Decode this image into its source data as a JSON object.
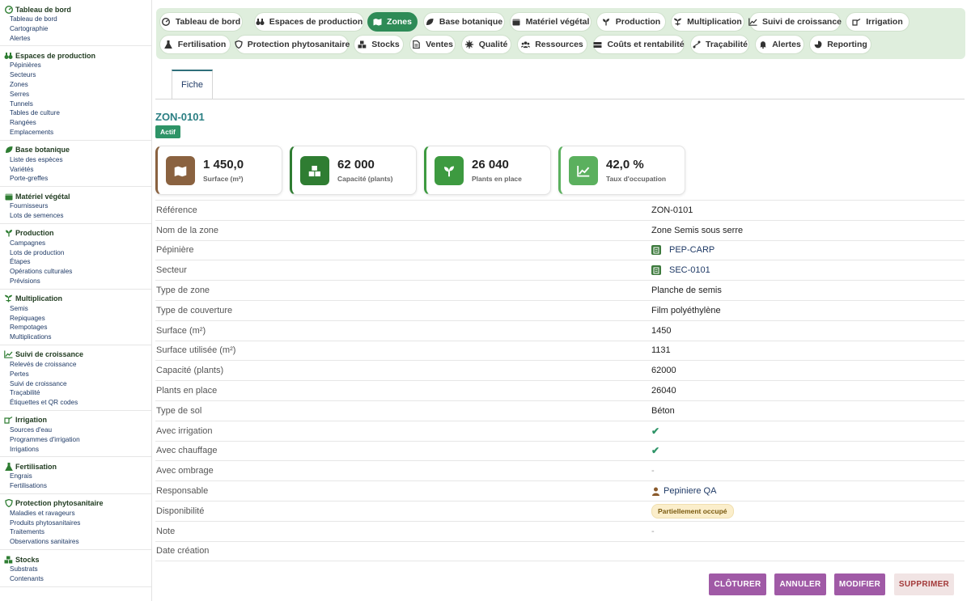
{
  "sidebar": {
    "sections": [
      {
        "title": "Tableau de bord",
        "icon": "dashboard-icon",
        "items": [
          "Tableau de bord",
          "Cartographie",
          "Alertes"
        ]
      },
      {
        "title": "Espaces de production",
        "icon": "binoculars-icon",
        "items": [
          "Pépinières",
          "Secteurs",
          "Zones",
          "Serres",
          "Tunnels",
          "Tables de culture",
          "Rangées",
          "Emplacements"
        ]
      },
      {
        "title": "Base botanique",
        "icon": "leaf-icon",
        "items": [
          "Liste des espèces",
          "Variétés",
          "Porte-greffes"
        ]
      },
      {
        "title": "Matériel végétal",
        "icon": "box-icon",
        "items": [
          "Fournisseurs",
          "Lots de semences"
        ]
      },
      {
        "title": "Production",
        "icon": "seedling-icon",
        "items": [
          "Campagnes",
          "Lots de production",
          "Étapes",
          "Opérations culturales",
          "Prévisions"
        ]
      },
      {
        "title": "Multiplication",
        "icon": "plant-icon",
        "items": [
          "Semis",
          "Repiquages",
          "Rempotages",
          "Multiplications"
        ]
      },
      {
        "title": "Suivi de croissance",
        "icon": "chart-icon",
        "items": [
          "Relevés de croissance",
          "Pertes",
          "Suivi de croissance",
          "Traçabilité",
          "Étiquettes et QR codes"
        ]
      },
      {
        "title": "Irrigation",
        "icon": "watering-icon",
        "items": [
          "Sources d'eau",
          "Programmes d'irrigation",
          "Irrigations"
        ]
      },
      {
        "title": "Fertilisation",
        "icon": "flask-icon",
        "items": [
          "Engrais",
          "Fertilisations"
        ]
      },
      {
        "title": "Protection phytosanitaire",
        "icon": "shield-icon",
        "items": [
          "Maladies et ravageurs",
          "Produits phytosanitaires",
          "Traitements",
          "Observations sanitaires"
        ]
      },
      {
        "title": "Stocks",
        "icon": "boxes-icon",
        "items": [
          "Substrats",
          "Contenants"
        ]
      }
    ]
  },
  "nav": {
    "row1": [
      {
        "label": "Tableau de bord",
        "icon": "dashboard-icon"
      },
      {
        "label": "Espaces de production",
        "icon": "binoculars-icon"
      },
      {
        "label": "Zones",
        "icon": "map-icon",
        "active": true
      },
      {
        "label": "Base botanique",
        "icon": "leaf-icon"
      },
      {
        "label": "Matériel végétal",
        "icon": "box-icon"
      },
      {
        "label": "Production",
        "icon": "seedling-icon"
      },
      {
        "label": "Multiplication",
        "icon": "plant-icon"
      },
      {
        "label": "Suivi de croissance",
        "icon": "chart-icon"
      },
      {
        "label": "Irrigation",
        "icon": "watering-icon"
      }
    ],
    "row2": [
      {
        "label": "Fertilisation",
        "icon": "flask-icon"
      },
      {
        "label": "Protection phytosanitaire",
        "icon": "shield-icon"
      },
      {
        "label": "Stocks",
        "icon": "boxes-icon"
      },
      {
        "label": "Ventes",
        "icon": "document-icon"
      },
      {
        "label": "Qualité",
        "icon": "star-icon"
      },
      {
        "label": "Ressources",
        "icon": "users-icon"
      },
      {
        "label": "Coûts et rentabilité",
        "icon": "money-icon"
      },
      {
        "label": "Traçabilité",
        "icon": "route-icon"
      },
      {
        "label": "Alertes",
        "icon": "bell-icon"
      },
      {
        "label": "Reporting",
        "icon": "pie-icon"
      }
    ]
  },
  "tab": {
    "label": "Fiche"
  },
  "record": {
    "title": "ZON-0101",
    "status": "Actif"
  },
  "kpis": [
    {
      "value": "1 450,0",
      "label": "Surface (m²)",
      "icon": "map-icon",
      "color": "#8a6240"
    },
    {
      "value": "62 000",
      "label": "Capacité (plants)",
      "icon": "boxes-icon",
      "color": "#2f7d32"
    },
    {
      "value": "26 040",
      "label": "Plants en place",
      "icon": "seedling-icon",
      "color": "#3d9a40"
    },
    {
      "value": "42,0 %",
      "label": "Taux d'occupation",
      "icon": "chart-icon",
      "color": "#5bb05e"
    }
  ],
  "details": [
    {
      "label": "Référence",
      "value": "ZON-0101"
    },
    {
      "label": "Nom de la zone",
      "value": "Zone Semis sous serre"
    },
    {
      "label": "Pépinière",
      "value": "PEP-CARP",
      "type": "link"
    },
    {
      "label": "Secteur",
      "value": "SEC-0101",
      "type": "link"
    },
    {
      "label": "Type de zone",
      "value": "Planche de semis"
    },
    {
      "label": "Type de couverture",
      "value": "Film polyéthylène"
    },
    {
      "label": "Surface (m²)",
      "value": "1450"
    },
    {
      "label": "Surface utilisée (m²)",
      "value": "1131"
    },
    {
      "label": "Capacité (plants)",
      "value": "62000"
    },
    {
      "label": "Plants en place",
      "value": "26040"
    },
    {
      "label": "Type de sol",
      "value": "Béton"
    },
    {
      "label": "Avec irrigation",
      "value": "✔",
      "type": "check"
    },
    {
      "label": "Avec chauffage",
      "value": "✔",
      "type": "check"
    },
    {
      "label": "Avec ombrage",
      "value": "-",
      "type": "muted"
    },
    {
      "label": "Responsable",
      "value": "Pepiniere QA",
      "type": "user"
    },
    {
      "label": "Disponibilité",
      "value": "Partiellement occupé",
      "type": "pill"
    },
    {
      "label": "Note",
      "value": "-",
      "type": "muted"
    },
    {
      "label": "Date création",
      "value": ""
    }
  ],
  "actions": [
    {
      "label": "CLÔTURER",
      "color": "#a05aa6"
    },
    {
      "label": "ANNULER",
      "color": "#a05aa6"
    },
    {
      "label": "MODIFIER",
      "color": "#a05aa6"
    },
    {
      "label": "SUPPRIMER",
      "color": "#f1e4e4",
      "text_color": "#a33a3a"
    }
  ],
  "colors": {
    "accent_green": "#2e8b57",
    "nav_bg": "#dfeedd",
    "title_teal": "#2b7f83",
    "link_blue": "#1f3a66"
  }
}
